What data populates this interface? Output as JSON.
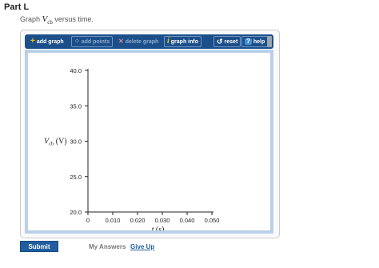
{
  "part": {
    "title": "Part L"
  },
  "instruction": {
    "prefix": "Graph ",
    "var_symbol": "V",
    "var_subscript": "cb",
    "suffix": " versus time."
  },
  "toolbar": {
    "add_graph": "add graph",
    "add_points": "add points",
    "delete_graph": "delete graph",
    "graph_info": "graph info",
    "reset": "reset",
    "help": "help",
    "icons": [
      "plus-icon",
      "points-icon",
      "delete-icon",
      "info-icon",
      "reset-icon",
      "help-icon"
    ]
  },
  "chart_data": {
    "type": "scatter",
    "series": [],
    "x_ticks": [
      "0",
      "0.010",
      "0.020",
      "0.030",
      "0.040",
      "0.050"
    ],
    "x_values": [
      0,
      0.01,
      0.02,
      0.03,
      0.04,
      0.05
    ],
    "y_ticks": [
      "20.0",
      "25.0",
      "30.0",
      "35.0",
      "40.0"
    ],
    "y_values": [
      20,
      25,
      30,
      35,
      40
    ],
    "xlim": [
      0,
      0.05
    ],
    "ylim": [
      20,
      40
    ],
    "xlabel_var": "t",
    "xlabel_unit": "(s)",
    "ylabel_var": "V",
    "ylabel_sub": "cb",
    "ylabel_unit": "(V)",
    "grid": false
  },
  "footer": {
    "submit": "Submit",
    "my_answers": "My Answers",
    "give_up": "Give Up"
  },
  "colors": {
    "toolbar": "#1c4f8a",
    "panel_border": "#b9d0e8",
    "submit": "#1f5d9e"
  }
}
